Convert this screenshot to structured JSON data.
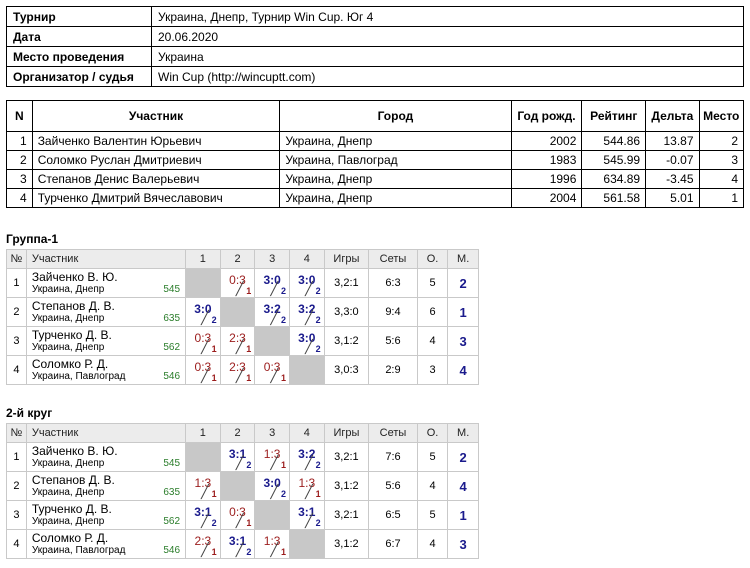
{
  "tournament": {
    "rows": [
      {
        "label": "Турнир",
        "value": "Украина, Днепр, Турнир Win Cup. Юг 4"
      },
      {
        "label": "Дата",
        "value": "20.06.2020"
      },
      {
        "label": "Место проведения",
        "value": "Украина"
      },
      {
        "label": "Организатор / судья",
        "value": "Win Cup (http://wincuptt.com)"
      }
    ]
  },
  "players": {
    "headers": [
      "N",
      "Участник",
      "Город",
      "Год рожд.",
      "Рейтинг",
      "Дельта",
      "Место"
    ],
    "rows": [
      {
        "n": "1",
        "name": "Зайченко Валентин Юрьевич",
        "city": "Украина, Днепр",
        "year": "2002",
        "rating": "544.86",
        "delta": "13.87",
        "place": "2"
      },
      {
        "n": "2",
        "name": "Соломко Руслан Дмитриевич",
        "city": "Украина, Павлоград",
        "year": "1983",
        "rating": "545.99",
        "delta": "-0.07",
        "place": "3"
      },
      {
        "n": "3",
        "name": "Степанов Денис Валерьевич",
        "city": "Украина, Днепр",
        "year": "1996",
        "rating": "634.89",
        "delta": "-3.45",
        "place": "4"
      },
      {
        "n": "4",
        "name": "Турченко Дмитрий Вячеславович",
        "city": "Украина, Днепр",
        "year": "2004",
        "rating": "561.58",
        "delta": "5.01",
        "place": "1"
      }
    ]
  },
  "groups": [
    {
      "title": "Группа-1",
      "headers": {
        "num": "№",
        "name": "Участник",
        "cols": [
          "1",
          "2",
          "3",
          "4"
        ],
        "games": "Игры",
        "sets": "Сеты",
        "points": "О.",
        "place": "М."
      },
      "rows": [
        {
          "num": "1",
          "name": "Зайченко В. Ю.",
          "city": "Украина, Днепр",
          "rating": "545",
          "cells": [
            null,
            {
              "score": "0:3",
              "pts": "1",
              "win": false
            },
            {
              "score": "3:0",
              "pts": "2",
              "win": true
            },
            {
              "score": "3:0",
              "pts": "2",
              "win": true
            }
          ],
          "games": "3,2:1",
          "sets": "6:3",
          "points": "5",
          "place": "2"
        },
        {
          "num": "2",
          "name": "Степанов Д. В.",
          "city": "Украина, Днепр",
          "rating": "635",
          "cells": [
            {
              "score": "3:0",
              "pts": "2",
              "win": true
            },
            null,
            {
              "score": "3:2",
              "pts": "2",
              "win": true
            },
            {
              "score": "3:2",
              "pts": "2",
              "win": true
            }
          ],
          "games": "3,3:0",
          "sets": "9:4",
          "points": "6",
          "place": "1"
        },
        {
          "num": "3",
          "name": "Турченко Д. В.",
          "city": "Украина, Днепр",
          "rating": "562",
          "cells": [
            {
              "score": "0:3",
              "pts": "1",
              "win": false
            },
            {
              "score": "2:3",
              "pts": "1",
              "win": false
            },
            null,
            {
              "score": "3:0",
              "pts": "2",
              "win": true
            }
          ],
          "games": "3,1:2",
          "sets": "5:6",
          "points": "4",
          "place": "3"
        },
        {
          "num": "4",
          "name": "Соломко Р. Д.",
          "city": "Украина, Павлоград",
          "rating": "546",
          "cells": [
            {
              "score": "0:3",
              "pts": "1",
              "win": false
            },
            {
              "score": "2:3",
              "pts": "1",
              "win": false
            },
            {
              "score": "0:3",
              "pts": "1",
              "win": false
            },
            null
          ],
          "games": "3,0:3",
          "sets": "2:9",
          "points": "3",
          "place": "4"
        }
      ]
    },
    {
      "title": "2-й круг",
      "headers": {
        "num": "№",
        "name": "Участник",
        "cols": [
          "1",
          "2",
          "3",
          "4"
        ],
        "games": "Игры",
        "sets": "Сеты",
        "points": "О.",
        "place": "М."
      },
      "rows": [
        {
          "num": "1",
          "name": "Зайченко В. Ю.",
          "city": "Украина, Днепр",
          "rating": "545",
          "cells": [
            null,
            {
              "score": "3:1",
              "pts": "2",
              "win": true
            },
            {
              "score": "1:3",
              "pts": "1",
              "win": false
            },
            {
              "score": "3:2",
              "pts": "2",
              "win": true
            }
          ],
          "games": "3,2:1",
          "sets": "7:6",
          "points": "5",
          "place": "2"
        },
        {
          "num": "2",
          "name": "Степанов Д. В.",
          "city": "Украина, Днепр",
          "rating": "635",
          "cells": [
            {
              "score": "1:3",
              "pts": "1",
              "win": false
            },
            null,
            {
              "score": "3:0",
              "pts": "2",
              "win": true
            },
            {
              "score": "1:3",
              "pts": "1",
              "win": false
            }
          ],
          "games": "3,1:2",
          "sets": "5:6",
          "points": "4",
          "place": "4"
        },
        {
          "num": "3",
          "name": "Турченко Д. В.",
          "city": "Украина, Днепр",
          "rating": "562",
          "cells": [
            {
              "score": "3:1",
              "pts": "2",
              "win": true
            },
            {
              "score": "0:3",
              "pts": "1",
              "win": false
            },
            null,
            {
              "score": "3:1",
              "pts": "2",
              "win": true
            }
          ],
          "games": "3,2:1",
          "sets": "6:5",
          "points": "5",
          "place": "1"
        },
        {
          "num": "4",
          "name": "Соломко Р. Д.",
          "city": "Украина, Павлоград",
          "rating": "546",
          "cells": [
            {
              "score": "2:3",
              "pts": "1",
              "win": false
            },
            {
              "score": "3:1",
              "pts": "2",
              "win": true
            },
            {
              "score": "1:3",
              "pts": "1",
              "win": false
            },
            null
          ],
          "games": "3,1:2",
          "sets": "6:7",
          "points": "4",
          "place": "3"
        }
      ]
    }
  ]
}
